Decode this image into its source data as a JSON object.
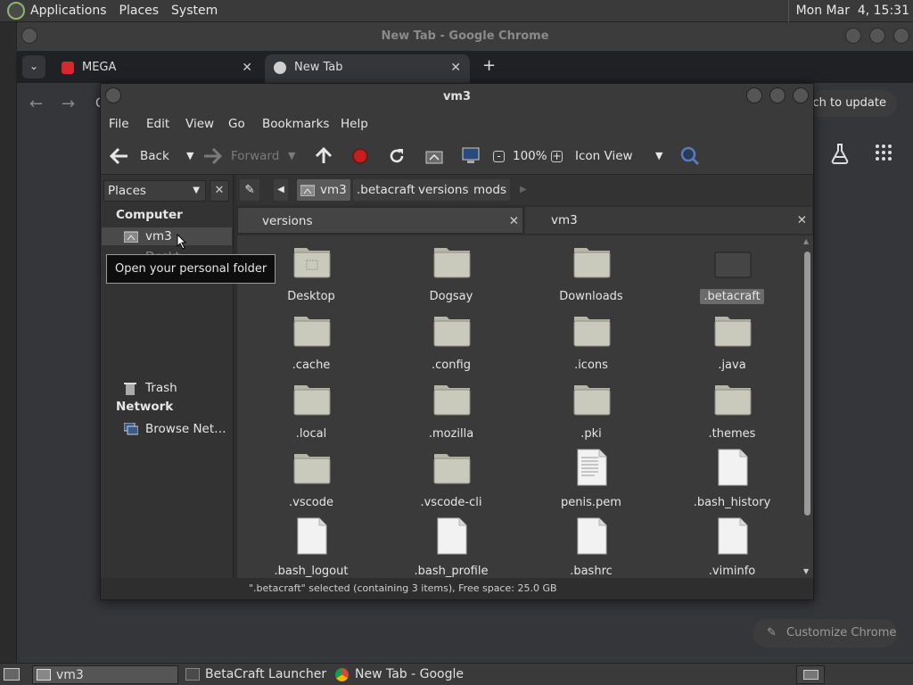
{
  "top_panel": {
    "menus": [
      "Applications",
      "Places",
      "System"
    ],
    "clock": "Mon Mar  4, 15:31"
  },
  "chrome": {
    "window_title": "New Tab - Google Chrome",
    "tabs": [
      {
        "label": "MEGA",
        "favicon": "mega-icon",
        "color": "#d9272e"
      },
      {
        "label": "New Tab",
        "favicon": "chrome-icon"
      }
    ],
    "address_prefix": "C",
    "relaunch_label": "nch to update",
    "customize_label": "Customize Chrome"
  },
  "file_manager": {
    "title": "vm3",
    "menu": [
      "File",
      "Edit",
      "View",
      "Go",
      "Bookmarks",
      "Help"
    ],
    "toolbar": {
      "back": "Back",
      "forward": "Forward",
      "zoom": "100%",
      "view_mode": "Icon View"
    },
    "sidebar": {
      "selector": "Places",
      "computer_heading": "Computer",
      "network_heading": "Network",
      "items": [
        {
          "label": "vm3",
          "icon": "home-folder-icon"
        },
        {
          "label": "Trash",
          "icon": "trash-icon"
        },
        {
          "label": "Browse Net…",
          "icon": "network-icon"
        }
      ],
      "hidden_item_partial": "Deskt",
      "tooltip": "Open your personal folder"
    },
    "breadcrumb": [
      "vm3",
      ".betacraft",
      "versions",
      "mods"
    ],
    "tabs": [
      "versions",
      "vm3"
    ],
    "files": [
      {
        "name": "Desktop",
        "type": "folder-desktop"
      },
      {
        "name": "Dogsay",
        "type": "folder"
      },
      {
        "name": "Downloads",
        "type": "folder"
      },
      {
        "name": ".betacraft",
        "type": "folder-dark",
        "selected": true
      },
      {
        "name": ".cache",
        "type": "folder"
      },
      {
        "name": ".config",
        "type": "folder"
      },
      {
        "name": ".icons",
        "type": "folder"
      },
      {
        "name": ".java",
        "type": "folder"
      },
      {
        "name": ".local",
        "type": "folder"
      },
      {
        "name": ".mozilla",
        "type": "folder"
      },
      {
        "name": ".pki",
        "type": "folder"
      },
      {
        "name": ".themes",
        "type": "folder"
      },
      {
        "name": ".vscode",
        "type": "folder"
      },
      {
        "name": ".vscode-cli",
        "type": "folder"
      },
      {
        "name": "penis.pem",
        "type": "text-file"
      },
      {
        "name": ".bash_history",
        "type": "file"
      },
      {
        "name": ".bash_logout",
        "type": "file"
      },
      {
        "name": ".bash_profile",
        "type": "file"
      },
      {
        "name": ".bashrc",
        "type": "file"
      },
      {
        "name": ".viminfo",
        "type": "file"
      }
    ],
    "status": "\".betacraft\" selected (containing 3 items), Free space: 25.0 GB"
  },
  "taskbar": {
    "items": [
      {
        "label": "vm3",
        "icon": "folder-icon"
      },
      {
        "label": "BetaCraft Launcher ...",
        "icon": "betacraft-icon"
      },
      {
        "label": "New Tab - Google C...",
        "icon": "chrome-icon"
      }
    ]
  }
}
